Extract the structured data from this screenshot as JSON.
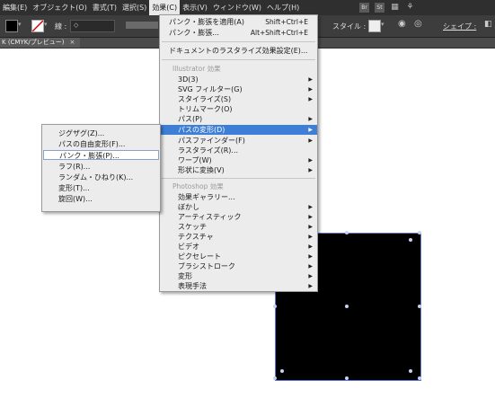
{
  "menubar": {
    "items": [
      {
        "label": "編集(E)"
      },
      {
        "label": "オブジェクト(O)"
      },
      {
        "label": "書式(T)"
      },
      {
        "label": "選択(S)"
      },
      {
        "label": "効果(C)"
      },
      {
        "label": "表示(V)"
      },
      {
        "label": "ウィンドウ(W)"
      },
      {
        "label": "ヘルプ(H)"
      }
    ],
    "active_index": 4,
    "right_icons": {
      "br": "Br",
      "st": "St"
    }
  },
  "controlbar": {
    "stroke_label": "線 :",
    "stroke_value": "◇",
    "style_label": "スタイル :",
    "shape_label": "シェイプ :"
  },
  "tab": {
    "title": "K (CMYK/プレビュー)",
    "close": "×"
  },
  "effect_menu": {
    "apply_last": {
      "label": "パンク・膨張を適用(A)",
      "shortcut": "Shift+Ctrl+E"
    },
    "last_effect": {
      "label": "パンク・膨張...",
      "shortcut": "Alt+Shift+Ctrl+E"
    },
    "document_raster": {
      "label": "ドキュメントのラスタライズ効果設定(E)..."
    },
    "illustrator_header": "Illustrator 効果",
    "illustrator_items": [
      {
        "label": "3D(3)"
      },
      {
        "label": "SVG フィルター(G)"
      },
      {
        "label": "スタイライズ(S)"
      },
      {
        "label": "トリムマーク(O)"
      },
      {
        "label": "パス(P)"
      },
      {
        "label": "パスの変形(D)"
      },
      {
        "label": "パスファインダー(F)"
      },
      {
        "label": "ラスタライズ(R)..."
      },
      {
        "label": "ワープ(W)"
      },
      {
        "label": "形状に変換(V)"
      }
    ],
    "photoshop_header": "Photoshop 効果",
    "photoshop_items": [
      {
        "label": "効果ギャラリー..."
      },
      {
        "label": "ぼかし"
      },
      {
        "label": "アーティスティック"
      },
      {
        "label": "スケッチ"
      },
      {
        "label": "テクスチャ"
      },
      {
        "label": "ビデオ"
      },
      {
        "label": "ピクセレート"
      },
      {
        "label": "ブラシストローク"
      },
      {
        "label": "変形"
      },
      {
        "label": "表現手法"
      }
    ],
    "submenu_arrow": "▶"
  },
  "distort_submenu": {
    "items": [
      {
        "label": "ジグザグ(Z)..."
      },
      {
        "label": "パスの自由変形(F)..."
      },
      {
        "label": "パンク・膨張(P)..."
      },
      {
        "label": "ラフ(R)..."
      },
      {
        "label": "ランダム・ひねり(K)..."
      },
      {
        "label": "変形(T)..."
      },
      {
        "label": "旋回(W)..."
      }
    ]
  },
  "colors": {
    "menubar_bg": "#2f2f2f",
    "menu_bg": "#ececec",
    "highlight": "#3d7fd6",
    "canvas_object": "#000000"
  }
}
